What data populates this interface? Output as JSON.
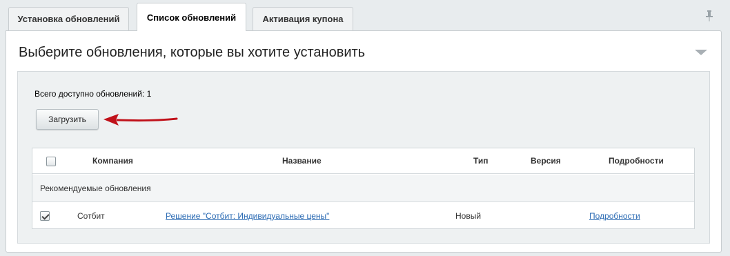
{
  "tabs": [
    {
      "label": "Установка обновлений",
      "active": false
    },
    {
      "label": "Список обновлений",
      "active": true
    },
    {
      "label": "Активация купона",
      "active": false
    }
  ],
  "icons": {
    "pin": "pin-icon",
    "collapse": "collapse-arrow-icon",
    "pointer": "red-arrow-icon"
  },
  "panel": {
    "title": "Выберите обновления, которые вы хотите установить",
    "total_text": "Всего доступно обновлений: 1",
    "load_button": "Загрузить"
  },
  "colors": {
    "pointer_arrow": "#c0111a",
    "link": "#2a6ab3"
  },
  "table": {
    "columns": [
      "Компания",
      "Название",
      "Тип",
      "Версия",
      "Подробности"
    ],
    "header_checkbox_checked": false,
    "group_label": "Рекомендуемые обновления",
    "rows": [
      {
        "checked": true,
        "company": "Сотбит",
        "name": "Решение \"Сотбит: Индивидуальные цены\"",
        "type": "Новый",
        "version": "",
        "details": "Подробности"
      }
    ]
  }
}
